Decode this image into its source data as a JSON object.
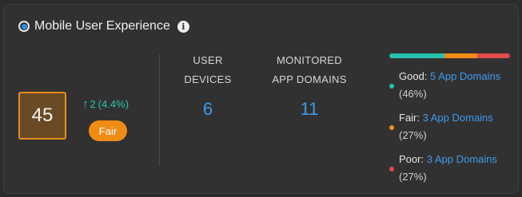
{
  "widget": {
    "title": "Mobile User Experience",
    "info_icon": "info-icon",
    "score": "45",
    "delta_arrow": "↑",
    "delta_value": "2",
    "delta_percent": "(4.4%)",
    "rating": "Fair"
  },
  "metrics": [
    {
      "label_line1": "USER",
      "label_line2": "DEVICES",
      "value": "6"
    },
    {
      "label_line1": "MONITORED",
      "label_line2": "APP DOMAINS",
      "value": "11"
    }
  ],
  "distribution": {
    "segments": [
      {
        "name": "Good",
        "fraction": 0.46,
        "color": "#26c2ae"
      },
      {
        "name": "Fair",
        "fraction": 0.27,
        "color": "#f08c16"
      },
      {
        "name": "Poor",
        "fraction": 0.27,
        "color": "#e04b4b"
      }
    ],
    "legend": [
      {
        "label": "Good:",
        "link": "5 App Domains",
        "pct": "(46%)",
        "color": "#26c2ae"
      },
      {
        "label": "Fair:",
        "link": "3 App Domains",
        "pct": "(27%)",
        "color": "#f08c16"
      },
      {
        "label": "Poor:",
        "link": "3 App Domains",
        "pct": "(27%)",
        "color": "#e04b4b"
      }
    ]
  },
  "colors": {
    "accent_blue": "#3d9bec",
    "fair_orange": "#f08c16",
    "score_bg": "#6a4a24",
    "delta_teal": "#28c7b0"
  }
}
